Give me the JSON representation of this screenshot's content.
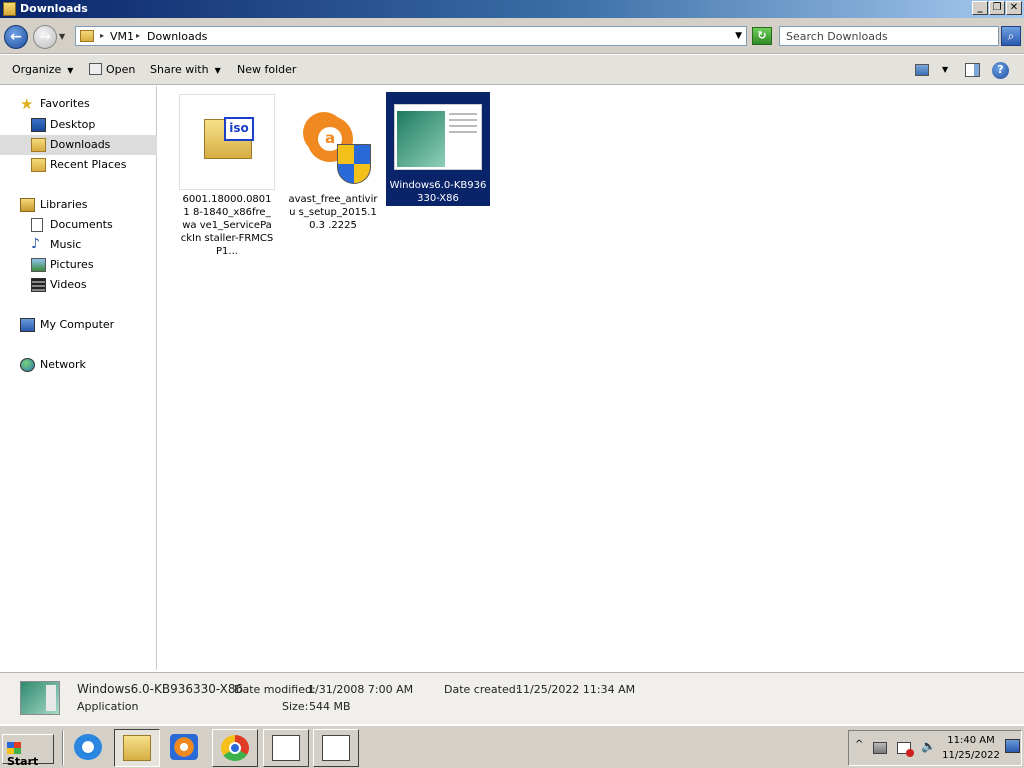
{
  "window": {
    "title": "Downloads"
  },
  "address": {
    "crumbs": [
      "VM1",
      "Downloads"
    ],
    "search_placeholder": "Search Downloads"
  },
  "toolbar": {
    "organize": "Organize",
    "open": "Open",
    "share_with": "Share with",
    "new_folder": "New folder"
  },
  "navpane": {
    "favorites": "Favorites",
    "desktop": "Desktop",
    "downloads": "Downloads",
    "recent": "Recent Places",
    "libraries": "Libraries",
    "documents": "Documents",
    "music": "Music",
    "pictures": "Pictures",
    "videos": "Videos",
    "computer": "My Computer",
    "network": "Network"
  },
  "files": [
    {
      "name": "6001.18000.080118-1840_x86fre_wave1_ServicePackInstaller-FRMCSP1...",
      "display": "6001.18000.08011 8-1840_x86fre_wa ve1_ServicePackIn staller-FRMCSP1...",
      "icon": "iso-file-icon",
      "badge": "iso"
    },
    {
      "name": "avast_free_antivirus_setup_2015.10.3.2225",
      "display": "avast_free_antiviru s_setup_2015.10.3 .2225",
      "icon": "avast-installer-icon"
    },
    {
      "name": "Windows6.0-KB936330-X86",
      "display": "Windows6.0-KB936 330-X86",
      "icon": "application-file-icon",
      "selected": true
    }
  ],
  "details": {
    "name": "Windows6.0-KB936330-X86",
    "type": "Application",
    "modified_label": "Date modified:",
    "modified_value": "1/31/2008 7:00 AM",
    "size_label": "Size:",
    "size_value": "544 MB",
    "created_label": "Date created:",
    "created_value": "11/25/2022 11:34 AM"
  },
  "taskbar": {
    "start": "Start",
    "time": "11:40 AM",
    "date": "11/25/2022"
  },
  "colors": {
    "selection": "#0a246a",
    "titlebar": "#0a246a"
  }
}
